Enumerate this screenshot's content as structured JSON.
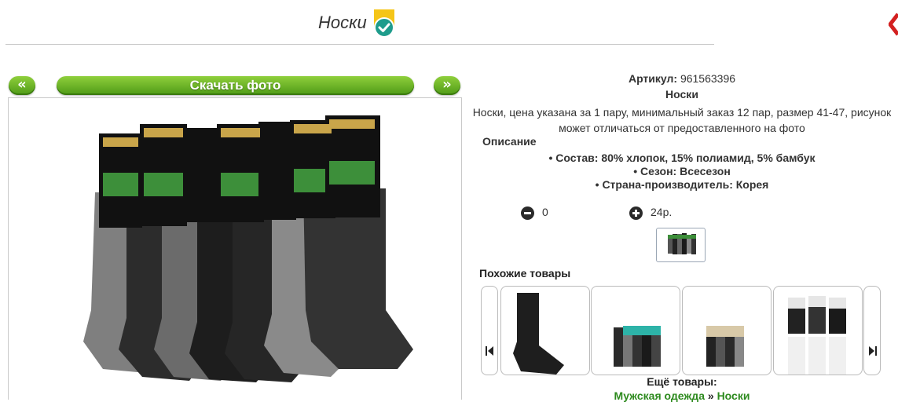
{
  "header": {
    "title": "Носки"
  },
  "nav": {
    "prev_label": "«",
    "next_label": "»",
    "download_label": "Скачать фото"
  },
  "product": {
    "sku_label": "Артикул:",
    "sku_value": "961563396",
    "name": "Носки",
    "description_line1": "Носки, цена указана за 1 пару, минимальный заказ 12 пар, размер 41-47, рисунок",
    "description_line2": "может отличаться от предоставленного на фото",
    "specs_heading": "Описание",
    "specs": [
      "Состав: 80% хлопок, 15% полиамид, 5% бамбук",
      "Сезон: Всесезон",
      "Страна-производитель: Корея"
    ],
    "quantity": "0",
    "price": "24р."
  },
  "similar": {
    "heading": "Похожие товары"
  },
  "footer": {
    "more_label": "Ещё товары:",
    "crumb1": "Мужская одежда",
    "sep": " » ",
    "crumb2": "Носки"
  },
  "colors": {
    "accent_green": "#5aa81e",
    "link_green": "#2d8a1e",
    "badge_teal": "#1e9c8c",
    "badge_yellow": "#f5c518"
  }
}
